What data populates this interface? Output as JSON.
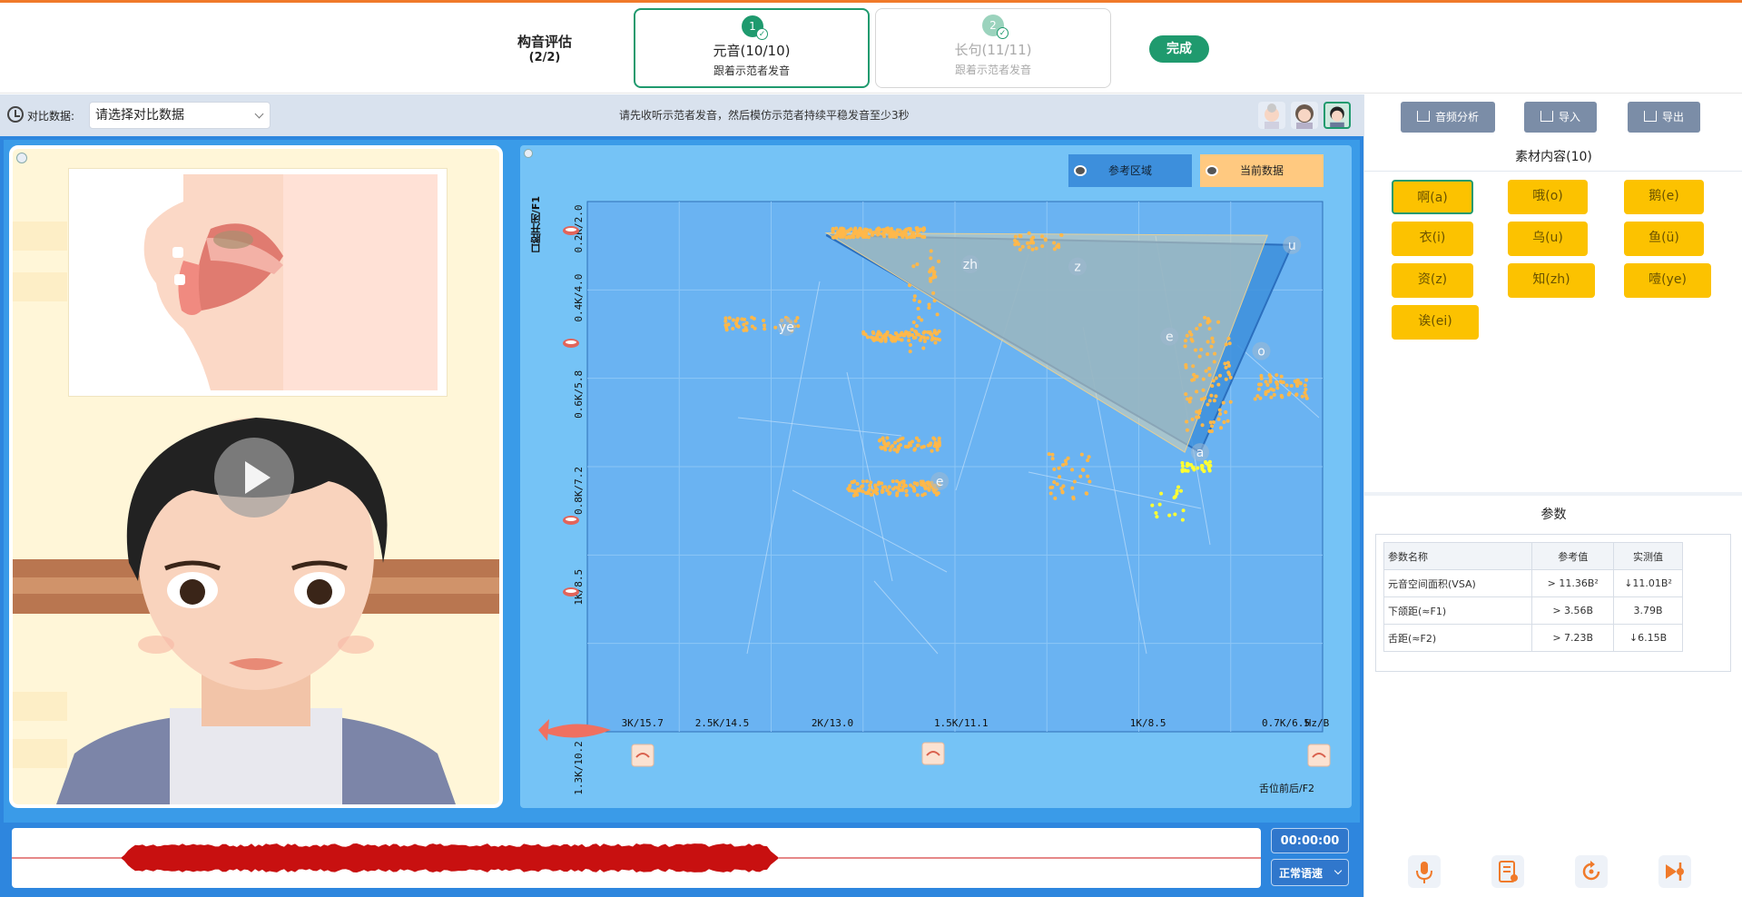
{
  "header": {
    "eval_title": "构音评估",
    "eval_progress": "(2/2)",
    "steps": [
      {
        "num": "1",
        "label": "元音(10/10)",
        "sub": "跟着示范者发音",
        "state": "active"
      },
      {
        "num": "2",
        "label": "长句(11/11)",
        "sub": "跟着示范者发音",
        "state": "inactive"
      }
    ],
    "done_label": "完成"
  },
  "toolbar": {
    "compare_label": "对比数据:",
    "compare_placeholder": "请选择对比数据",
    "instruction": "请先收听示范者发音，然后模仿示范者持续平稳发音至少3秒"
  },
  "chart_data": {
    "type": "scatter",
    "title": "",
    "xlabel": "舌位前后/F2",
    "ylabel": "口腔开闭/F1",
    "x_tick_labels": [
      "3K/15.7",
      "2.5K/14.5",
      "2K/13.0",
      "1.5K/11.1",
      "1K/8.5",
      "0.7K/6.5",
      "Hz/B"
    ],
    "y_tick_labels": [
      "0.2K/2.0",
      "0.4K/4.0",
      "0.6K/5.8",
      "0.8K/7.2",
      "1K/8.5",
      "1.3K/10.2"
    ],
    "legend": [
      "参考区域",
      "当前数据"
    ],
    "reference_vowels": [
      {
        "label": "zh",
        "f2": 1750,
        "f1": 330
      },
      {
        "label": "z",
        "f2": 1400,
        "f1": 335
      },
      {
        "label": "ye",
        "f2": 2350,
        "f1": 460
      },
      {
        "label": "e",
        "f2": 1100,
        "f1": 480
      },
      {
        "label": "o",
        "f2": 800,
        "f1": 510
      },
      {
        "label": "u",
        "f2": 700,
        "f1": 290
      },
      {
        "label": "a",
        "f2": 1000,
        "f1": 720
      },
      {
        "label": "e",
        "f2": 1850,
        "f1": 780
      }
    ],
    "colors": {
      "reference_area": "#3d8fdc",
      "current_data": "#ffc980",
      "current_point": "#ffff33"
    }
  },
  "playback": {
    "time": "00:00:00",
    "speed": "正常语速"
  },
  "right": {
    "tools": {
      "analysis": "音频分析",
      "import": "导入",
      "export": "导出"
    },
    "materials_title": "素材内容(10)",
    "materials": [
      "啊(a)",
      "哦(o)",
      "鹅(e)",
      "衣(i)",
      "乌(u)",
      "鱼(ü)",
      "资(z)",
      "知(zh)",
      "噎(ye)",
      "诶(ei)"
    ],
    "params_title": "参数",
    "params_headers": [
      "参数名称",
      "参考值",
      "实测值"
    ],
    "params_rows": [
      {
        "name": "元音空间面积(VSA)",
        "ref": "> 11.36B²",
        "measured": "↓11.01B²"
      },
      {
        "name": "下颌距(≈F1)",
        "ref": "> 3.56B",
        "measured": "3.79B"
      },
      {
        "name": "舌距(≈F2)",
        "ref": "> 7.23B",
        "measured": "↓6.15B"
      }
    ]
  }
}
